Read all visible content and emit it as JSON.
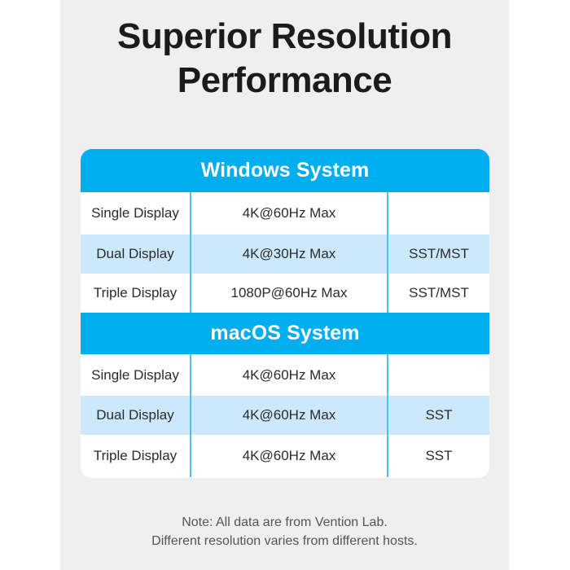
{
  "page": {
    "title_line1": "Superior Resolution",
    "title_line2": "Performance",
    "background_color": "#efeff0",
    "accent_color": "#00ADEF",
    "tint_row_color": "#cbe9fa",
    "divider_color": "#4cc3ef"
  },
  "table": {
    "sections": [
      {
        "header": "Windows System",
        "rows": [
          {
            "display": "Single Display",
            "resolution": "4K@60Hz Max",
            "mode": ""
          },
          {
            "display": "Dual Display",
            "resolution": "4K@30Hz Max",
            "mode": "SST/MST"
          },
          {
            "display": "Triple Display",
            "resolution": "1080P@60Hz Max",
            "mode": "SST/MST"
          }
        ]
      },
      {
        "header": "macOS System",
        "rows": [
          {
            "display": "Single Display",
            "resolution": "4K@60Hz Max",
            "mode": ""
          },
          {
            "display": "Dual Display",
            "resolution": "4K@60Hz Max",
            "mode": "SST"
          },
          {
            "display": "Triple Display",
            "resolution": "4K@60Hz Max",
            "mode": "SST"
          }
        ]
      }
    ]
  },
  "note": {
    "line1": "Note: All data are from Vention Lab.",
    "line2": "Different resolution varies from different hosts."
  }
}
